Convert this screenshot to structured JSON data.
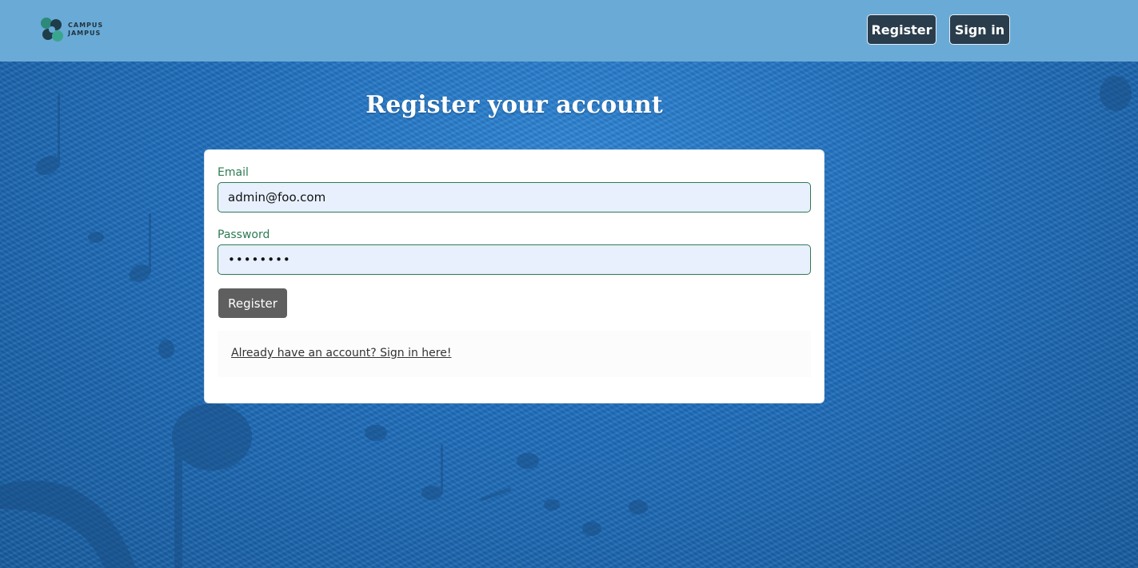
{
  "navbar": {
    "brand": {
      "line1": "CAMPUS",
      "line2": "JAMPUS",
      "icon": "campus-jampus-logo"
    },
    "register_label": "Register",
    "signin_label": "Sign in"
  },
  "page": {
    "title": "Register your account"
  },
  "form": {
    "email_label": "Email",
    "email_value": "admin@foo.com",
    "password_label": "Password",
    "password_value": "••••••••",
    "submit_label": "Register"
  },
  "footer_link": {
    "text": "Already have an account? Sign in here!"
  },
  "colors": {
    "navbar_bg": "#6aaad6",
    "nav_button_bg": "#2a3d4d",
    "label_green": "#2e7a53",
    "input_bg": "#e8f0fe",
    "submit_bg": "#5f5f5f",
    "page_bg": "#1e6bb5"
  }
}
